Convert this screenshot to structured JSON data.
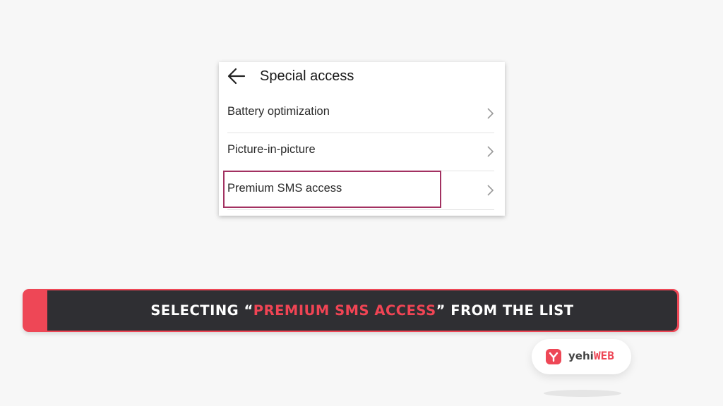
{
  "screen": {
    "title": "Special access",
    "items": [
      {
        "label": "Battery optimization"
      },
      {
        "label": "Picture-in-picture"
      },
      {
        "label": "Premium SMS access"
      }
    ]
  },
  "caption": {
    "prefix": "SELECTING “",
    "highlight": "PREMIUM SMS ACCESS",
    "suffix": "” FROM THE LIST"
  },
  "logo": {
    "part1": "yehi",
    "part2": "WEB"
  },
  "colors": {
    "accent": "#ee4756",
    "highlight_border": "#a23161",
    "caption_bg": "#2f2f33"
  },
  "icons": {
    "back": "back-arrow-icon",
    "chevron": "chevron-right-icon",
    "logo": "yehiweb-logo-icon"
  }
}
